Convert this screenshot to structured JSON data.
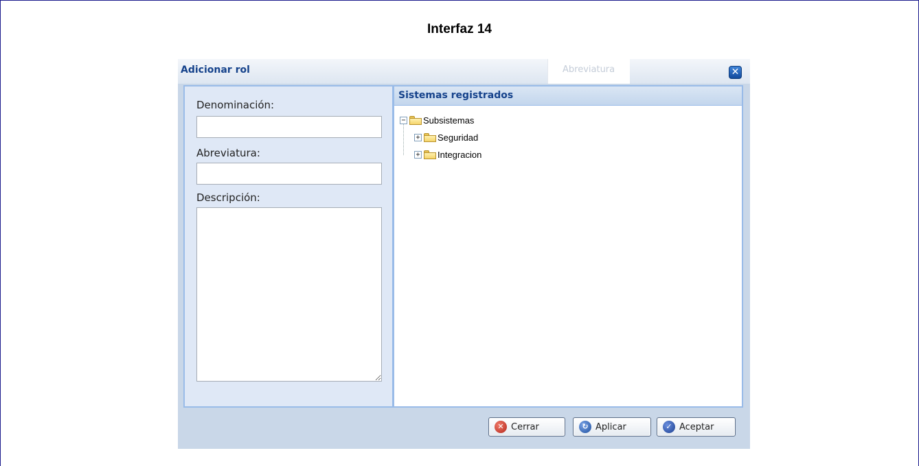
{
  "document": {
    "title": "Interfaz 14"
  },
  "dialog": {
    "title": "Adicionar rol",
    "ghost_column_label": "Abreviatura",
    "close_symbol": "✕"
  },
  "form": {
    "denominacion_label": "Denominación:",
    "denominacion_value": "",
    "abreviatura_label": "Abreviatura:",
    "abreviatura_value": "",
    "descripcion_label": "Descripción:",
    "descripcion_value": ""
  },
  "tree_panel": {
    "header": "Sistemas registrados",
    "root": {
      "label": "Subsistemas",
      "expanded": true,
      "toggle": "−"
    },
    "children": [
      {
        "label": "Seguridad",
        "expanded": false,
        "toggle": "+"
      },
      {
        "label": "Integracion",
        "expanded": false,
        "toggle": "+"
      }
    ]
  },
  "buttons": {
    "close_label": "Cerrar",
    "close_icon": "x-circle-icon",
    "apply_label": "Aplicar",
    "apply_icon": "refresh-icon",
    "accept_label": "Aceptar",
    "accept_icon": "check-circle-icon"
  },
  "colors": {
    "title_text": "#15428b",
    "panel_border": "#99bbe8",
    "dialog_bg": "#c9d7e8",
    "left_panel_bg": "#dfe8f6"
  }
}
